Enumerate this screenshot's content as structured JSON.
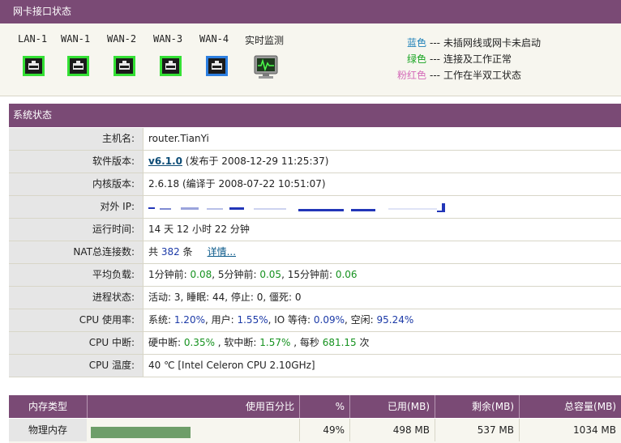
{
  "interfaces": {
    "title": "网卡接口状态",
    "ports": [
      {
        "label": "LAN-1",
        "state": "green"
      },
      {
        "label": "WAN-1",
        "state": "green"
      },
      {
        "label": "WAN-2",
        "state": "green"
      },
      {
        "label": "WAN-3",
        "state": "green"
      },
      {
        "label": "WAN-4",
        "state": "blue"
      }
    ],
    "monitor_label": "实时监测",
    "legend": [
      {
        "color_name": "蓝色",
        "color": "#1c7fb8",
        "desc": "未插网线或网卡未启动"
      },
      {
        "color_name": "绿色",
        "color": "#16a31f",
        "desc": "连接及工作正常"
      },
      {
        "color_name": "粉红色",
        "color": "#d46ab8",
        "desc": "工作在半双工状态"
      }
    ],
    "legend_dash": "---"
  },
  "system": {
    "title": "系统状态",
    "hostname": {
      "label": "主机名:",
      "value": "router.TianYi"
    },
    "software": {
      "label": "软件版本:",
      "version": "v6.1.0",
      "rest": " (发布于  2008-12-29 11:25:37)"
    },
    "kernel": {
      "label": "内核版本:",
      "value": "2.6.18 (编译于  2008-07-22 10:51:07)"
    },
    "ip": {
      "label": "对外  IP:",
      "value": ""
    },
    "uptime": {
      "label": "运行时间:",
      "value": "14 天  12 小时  22 分钟"
    },
    "nat": {
      "label": "NAT总连接数:",
      "prefix": "共 ",
      "count": "382",
      "suffix": " 条",
      "detail": "详情..."
    },
    "load": {
      "label": "平均负载:",
      "l1_label": "1分钟前: ",
      "l1": "0.08",
      "l5_label": ", 5分钟前: ",
      "l5": "0.05",
      "l15_label": ", 15分钟前: ",
      "l15": "0.06"
    },
    "process": {
      "label": "进程状态:",
      "value": "活动: 3, 睡眠: 44, 停止: 0, 僵死: 0"
    },
    "cpu": {
      "label": "CPU 使用率:",
      "sys_label": "系统: ",
      "sys": "1.20%",
      "user_label": ", 用户: ",
      "user": "1.55%",
      "io_label": ", IO 等待: ",
      "io": "0.09%",
      "idle_label": ", 空闲: ",
      "idle": "95.24%"
    },
    "irq": {
      "label": "CPU 中断:",
      "hard_label": "硬中断: ",
      "hard": "0.35%",
      "soft_label": " , 软中断: ",
      "soft": "1.57%",
      "rate_label": " , 每秒  ",
      "rate": "681.15",
      "rate_unit": " 次"
    },
    "temp": {
      "label": "CPU 温度:",
      "value": "40 ℃  [Intel Celeron CPU 2.10GHz]"
    }
  },
  "memory": {
    "headers": [
      "内存类型",
      "使用百分比",
      "%",
      "已用(MB)",
      "剩余(MB)",
      "总容量(MB)"
    ],
    "rows": [
      {
        "type": "物理内存",
        "usage": 0.49,
        "percent": "49%",
        "used": "498 MB",
        "free": "537 MB",
        "total": "1034 MB"
      }
    ]
  }
}
